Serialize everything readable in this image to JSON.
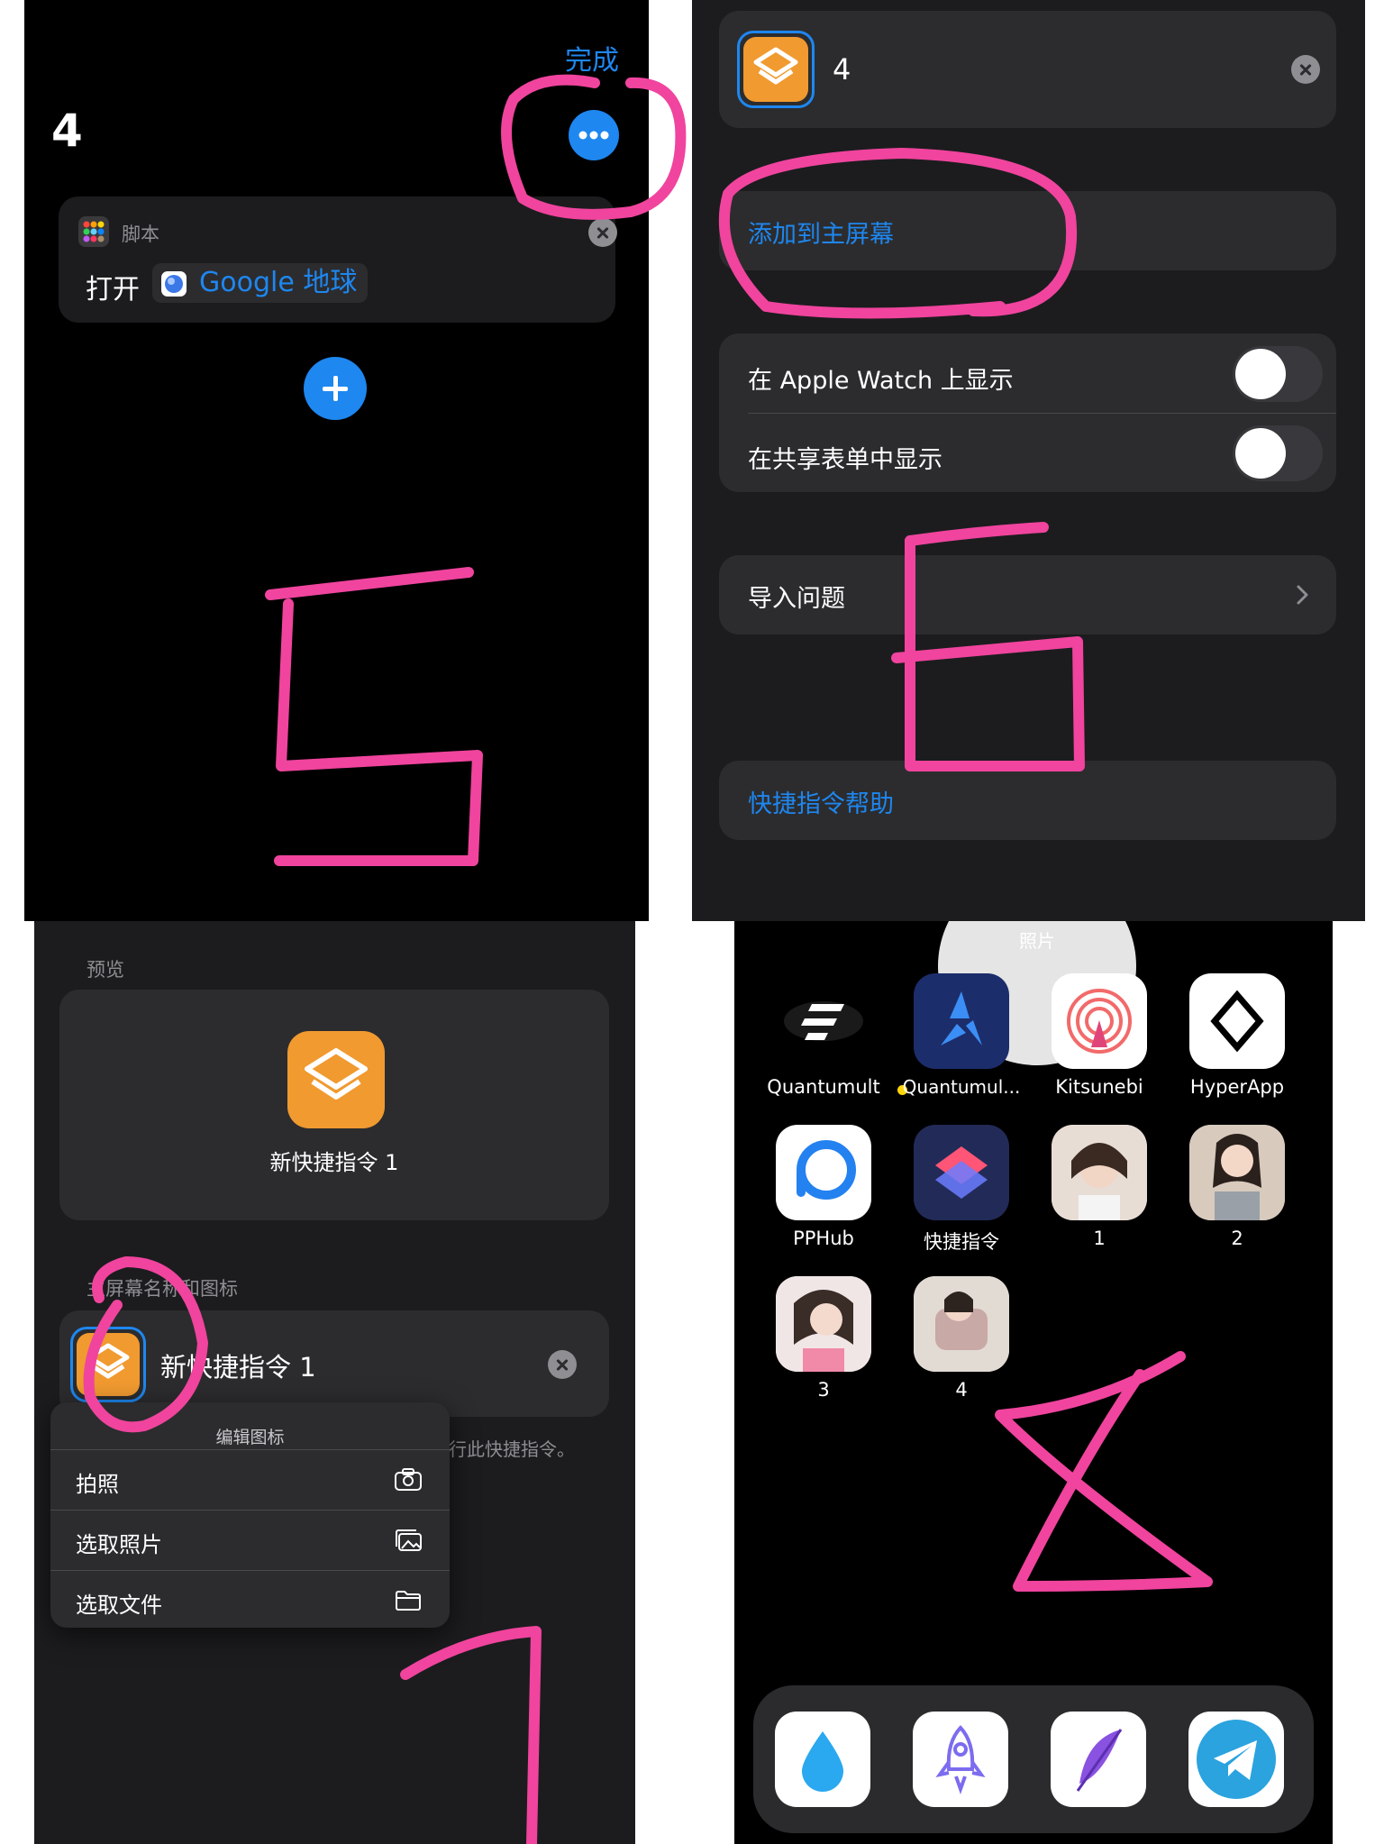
{
  "panel_a": {
    "done": "完成",
    "title": "4",
    "card_category": "脚本",
    "card_action": "打开",
    "card_app": "Google 地球",
    "handwritten_number": "5"
  },
  "panel_b": {
    "shortcut_name": "4",
    "add_home": "添加到主屏幕",
    "apple_watch": "在 Apple Watch 上显示",
    "share_sheet": "在共享表单中显示",
    "import_q": "导入问题",
    "help": "快捷指令帮助",
    "handwritten_number": "6"
  },
  "panel_c": {
    "preview_label": "预览",
    "preview_name": "新快捷指令 1",
    "section_label": "主屏幕名称和图标",
    "name_value": "新快捷指令 1",
    "hint": "行此快捷指令。",
    "menu_title": "编辑图标",
    "menu_items": [
      "拍照",
      "选取照片",
      "选取文件"
    ],
    "handwritten_number": "7"
  },
  "panel_d": {
    "top_label": "照片",
    "apps": [
      {
        "label": "Quantumult",
        "icon": "quantumult-icon"
      },
      {
        "label": "Quantumul...",
        "icon": "quantumult-x-icon",
        "dot": true
      },
      {
        "label": "Kitsunebi",
        "icon": "kitsunebi-icon"
      },
      {
        "label": "HyperApp",
        "icon": "hyperapp-icon"
      },
      {
        "label": "PPHub",
        "icon": "pphub-icon"
      },
      {
        "label": "快捷指令",
        "icon": "shortcuts-icon"
      },
      {
        "label": "1",
        "icon": "photo-shortcut-icon"
      },
      {
        "label": "2",
        "icon": "photo-shortcut-icon"
      },
      {
        "label": "3",
        "icon": "photo-shortcut-icon"
      },
      {
        "label": "4",
        "icon": "photo-shortcut-icon"
      }
    ],
    "dock": [
      "drop-icon",
      "rocket-icon",
      "feather-icon",
      "telegram-icon"
    ],
    "handwritten_number": "8"
  },
  "colors": {
    "accent": "#1e87f0",
    "annotation": "#f0449e",
    "shortcut_orange": "#f09a30"
  }
}
